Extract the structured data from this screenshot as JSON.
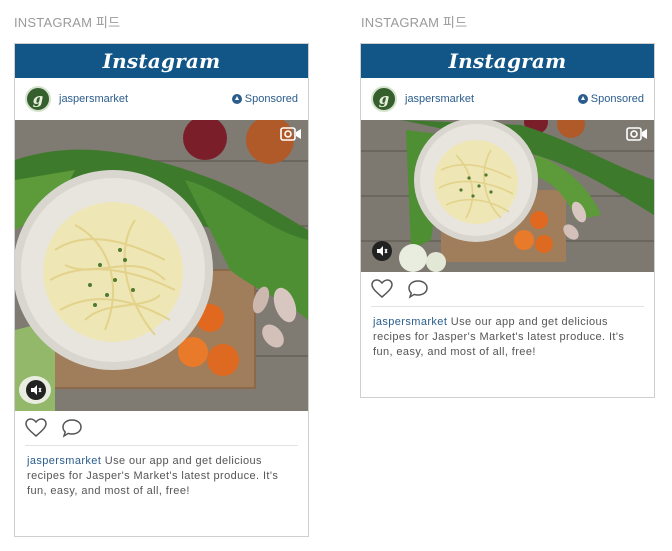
{
  "sections": [
    {
      "title": "INSTAGRAM 피드",
      "brand": "Instagram",
      "avatar_letter": "g",
      "username": "jaspersmarket",
      "sponsored": "Sponsored",
      "media_icons": [
        "camera-icon",
        "mute-icon"
      ],
      "actions": [
        "heart-icon",
        "comment-icon"
      ],
      "caption_user": "jaspersmarket",
      "caption_text": " Use our app and get delicious recipes for Jasper's Market's latest produce. It's fun, easy, and most of all, free!"
    },
    {
      "title": "INSTAGRAM 피드",
      "brand": "Instagram",
      "avatar_letter": "g",
      "username": "jaspersmarket",
      "sponsored": "Sponsored",
      "media_icons": [
        "camera-icon",
        "mute-icon"
      ],
      "actions": [
        "heart-icon",
        "comment-icon"
      ],
      "caption_user": "jaspersmarket",
      "caption_text": " Use our app and get delicious recipes for Jasper's Market's latest produce. It's fun, easy, and most of all, free!"
    }
  ],
  "colors": {
    "header": "#125688",
    "link": "#2b5d8c",
    "border": "#cfcfcf"
  }
}
